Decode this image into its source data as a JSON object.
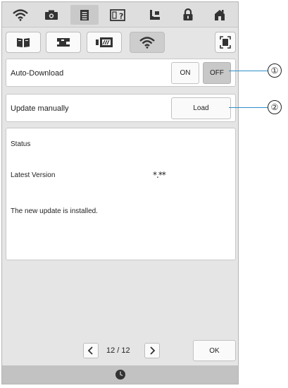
{
  "auto_download": {
    "label": "Auto-Download",
    "on_label": "ON",
    "off_label": "OFF",
    "selected": "OFF"
  },
  "update_manually": {
    "label": "Update manually",
    "load_label": "Load"
  },
  "status_panel": {
    "status_label": "Status",
    "latest_version_label": "Latest Version",
    "latest_version_value": "*.**",
    "message": "The new update is installed."
  },
  "pagination": {
    "page_text": "12 / 12"
  },
  "footer": {
    "ok_label": "OK"
  },
  "callouts": [
    "①",
    "②"
  ],
  "icons": {
    "top_tabs": [
      "wifi-icon",
      "camera-icon",
      "document-icon",
      "help-icon",
      "sewing-icon",
      "lock-icon",
      "home-icon"
    ],
    "sub_tabs": [
      "book-icon",
      "machine-icon",
      "embroidery-icon",
      "wifi-icon",
      "fullscreen-icon"
    ],
    "status_bar": "clock-icon"
  },
  "colors": {
    "background": "#e5e5e5",
    "selected_button": "#c8c8c8",
    "callout_line": "#2e8fc9"
  }
}
